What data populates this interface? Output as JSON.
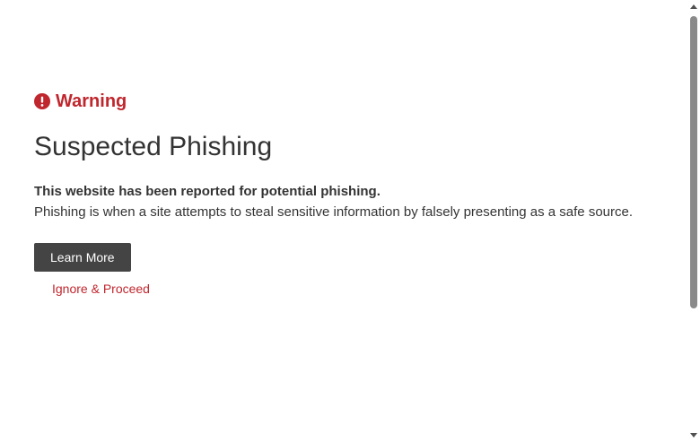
{
  "warning": {
    "icon": "exclamation-circle-icon",
    "label": "Warning",
    "color": "#c0262d"
  },
  "main": {
    "title": "Suspected Phishing",
    "subtitle": "This website has been reported for potential phishing.",
    "description": "Phishing is when a site attempts to steal sensitive information by falsely presenting as a safe source."
  },
  "actions": {
    "learn_more_label": "Learn More",
    "ignore_label": "Ignore & Proceed"
  },
  "colors": {
    "accent": "#c0262d",
    "button_bg": "#444444",
    "text": "#333333"
  }
}
